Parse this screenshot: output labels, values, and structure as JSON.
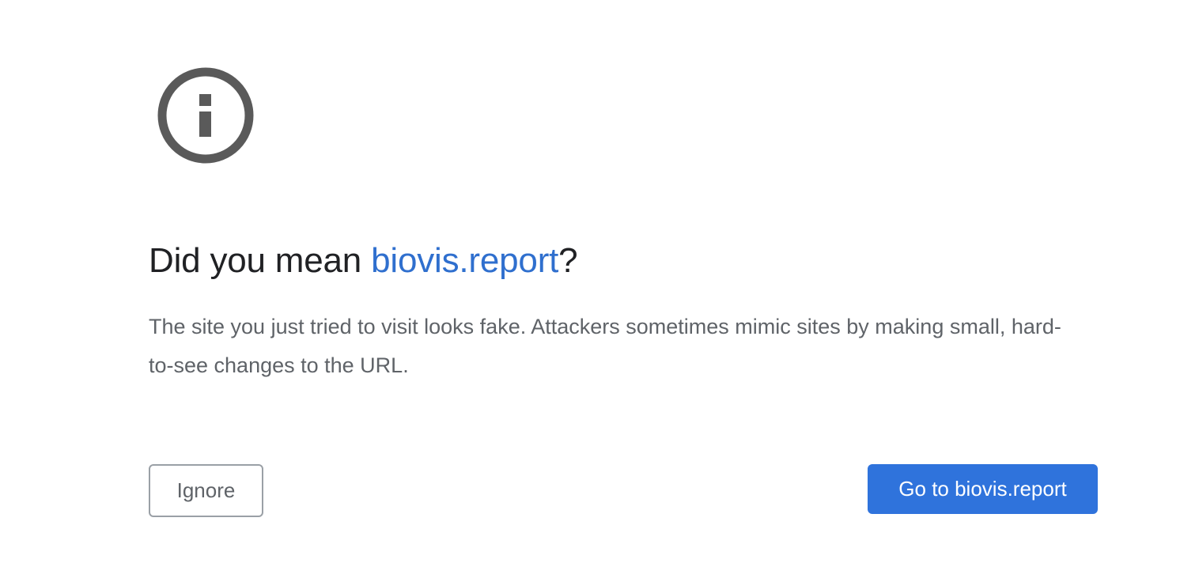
{
  "icon": {
    "name": "info-icon",
    "color": "#5a5a5a"
  },
  "headline": {
    "prefix": "Did you mean ",
    "suggested_site": "biovis.report",
    "suffix": "?"
  },
  "description": "The site you just tried to visit looks fake. Attackers sometimes mimic sites by making small, hard-to-see changes to the URL.",
  "buttons": {
    "ignore_label": "Ignore",
    "go_label": "Go to biovis.report"
  },
  "colors": {
    "link": "#2f6fce",
    "primary_button": "#2f73dc",
    "heading_text": "#202124",
    "body_text": "#5f6368"
  }
}
